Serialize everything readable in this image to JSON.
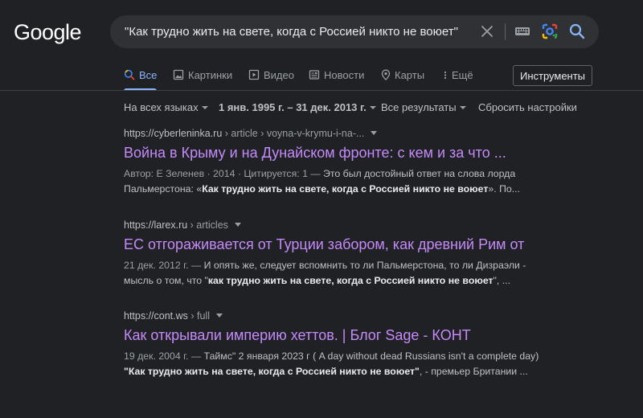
{
  "logo": "Google",
  "search": {
    "query": "\"Как трудно жить на свете, когда с Россией никто не воюет\"",
    "icons": [
      "close-icon",
      "keyboard-icon",
      "lens-icon",
      "search-icon"
    ]
  },
  "tabs": [
    {
      "label": "Все",
      "icon": "search-icon",
      "active": true
    },
    {
      "label": "Картинки",
      "icon": "image-icon"
    },
    {
      "label": "Видео",
      "icon": "video-icon"
    },
    {
      "label": "Новости",
      "icon": "news-icon"
    },
    {
      "label": "Карты",
      "icon": "map-pin-icon"
    },
    {
      "label": "Ещё",
      "icon": "more-vert-icon"
    }
  ],
  "tools_label": "Инструменты",
  "filters": {
    "language": "На всех языках",
    "date_range": "1 янв. 1995 г. – 31 дек. 2013 г.",
    "results": "Все результаты",
    "reset": "Сбросить настройки"
  },
  "results": [
    {
      "domain": "https://cyberleninka.ru",
      "path": " › article › voyna-v-krymu-i-na-...",
      "title": "Война в Крыму и на Дунайском фронте: с кем и за что ...",
      "line1_meta": "Автор: Е Зеленев · 2014 · Цитируется: 1 — ",
      "line1_text": "Это был достойный ответ на слова лорда",
      "line2_pre": "Пальмерстона: «",
      "line2_bold": "Как трудно жить на свете, когда с Россией никто не воюет",
      "line2_post": "». По..."
    },
    {
      "domain": "https://larex.ru",
      "path": " › articles",
      "title": "ЕС отгораживается от Турции забором, как древний Рим от",
      "line1_meta": "21 дек. 2012 г. — ",
      "line1_text": "И опять же, следует вспомнить то ли Пальмерстона, то ли Дизраэли -",
      "line2_pre": "мысль о том, что \"",
      "line2_bold": "как трудно жить на свете, когда с Россией никто не воюет",
      "line2_post": "\", ..."
    },
    {
      "domain": "https://cont.ws",
      "path": " › full",
      "title": "Как открывали империю хеттов. | Блог Sage - КОНТ",
      "line1_meta": "19 дек. 2004 г. — ",
      "line1_text": "Таймс\" 2 января 2023 г ( A day without dead Russians isn't a complete day)",
      "line2_pre": "",
      "line2_bold": "\"Как трудно жить на свете, когда с Россией никто не воюет\"",
      "line2_post": ", - премьер Британии ..."
    }
  ]
}
